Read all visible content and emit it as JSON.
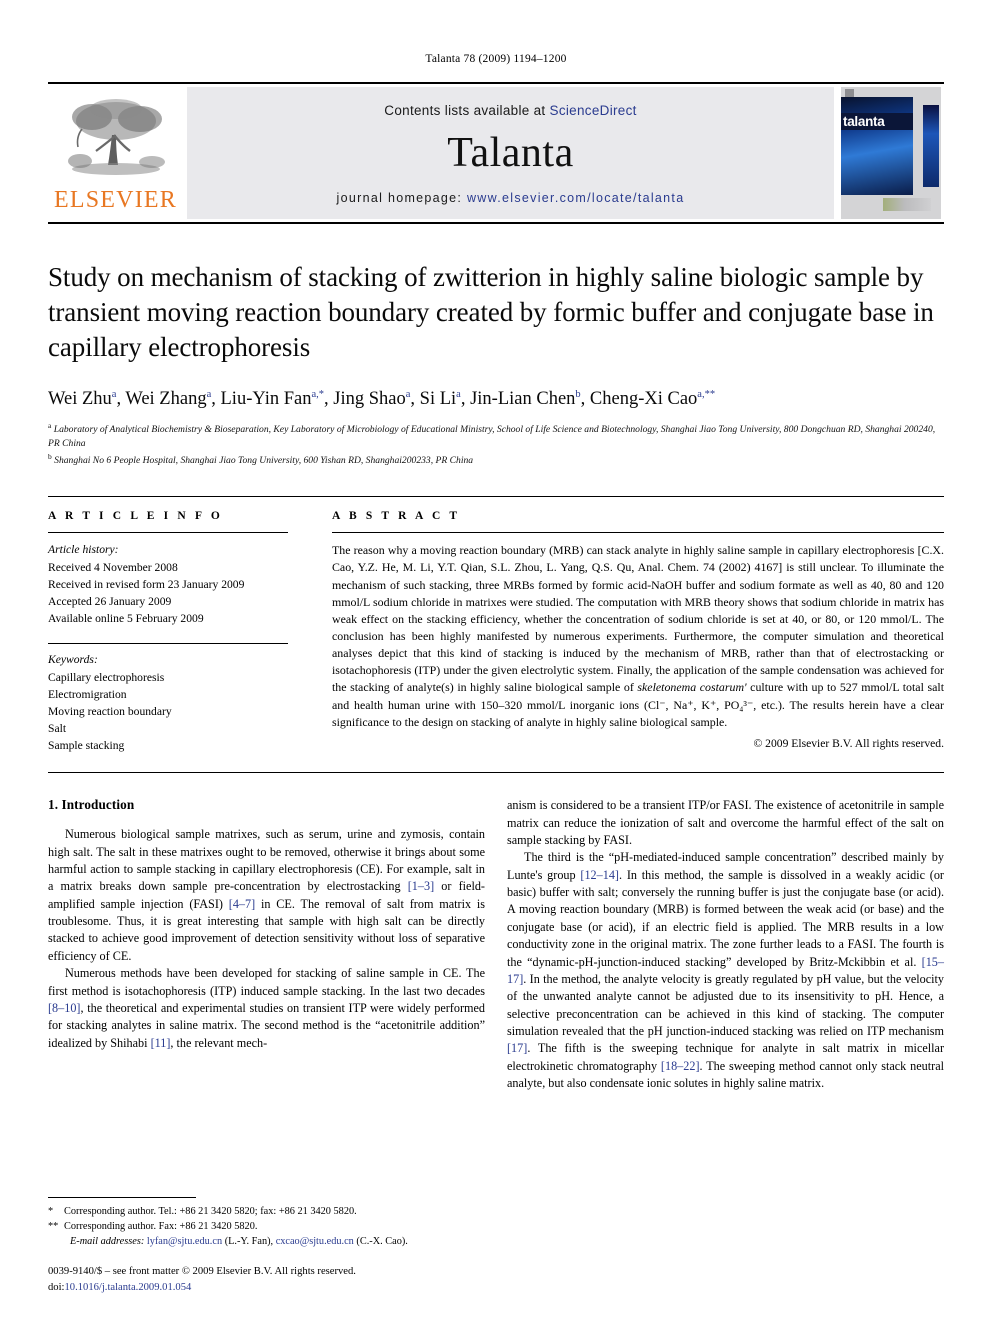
{
  "running_head": "Talanta 78 (2009) 1194–1200",
  "masthead": {
    "publisher_logo_word": "ELSEVIER",
    "contents_prefix": "Contents lists available at",
    "contents_link": "ScienceDirect",
    "journal_name": "Talanta",
    "homepage_prefix": "journal homepage:",
    "homepage_url": "www.elsevier.com/locate/talanta",
    "cover_title": "talanta",
    "link_color": "#2a3b8f",
    "elsevier_orange": "#E87722"
  },
  "article": {
    "title": "Study on mechanism of stacking of zwitterion in highly saline biologic sample by transient moving reaction boundary created by formic buffer and conjugate base in capillary electrophoresis",
    "authors": "Wei Zhu, Wei Zhang, Liu-Yin Fan, Jing Shao, Si Li, Jin-Lian Chen, Cheng-Xi Cao",
    "affiliation_a": "Laboratory of Analytical Biochemistry & Bioseparation, Key Laboratory of Microbiology of Educational Ministry, School of Life Science and Biotechnology, Shanghai Jiao Tong University, 800 Dongchuan RD, Shanghai 200240, PR China",
    "affiliation_b": "Shanghai No 6 People Hospital, Shanghai Jiao Tong University, 600 Yishan RD, Shanghai200233, PR China"
  },
  "info": {
    "heading": "A R T I C L E    I N F O",
    "history_label": "Article history:",
    "history": [
      "Received 4 November 2008",
      "Received in revised form 23 January 2009",
      "Accepted 26 January 2009",
      "Available online 5 February 2009"
    ],
    "keywords_label": "Keywords:",
    "keywords": [
      "Capillary electrophoresis",
      "Electromigration",
      "Moving reaction boundary",
      "Salt",
      "Sample stacking"
    ]
  },
  "abstract": {
    "heading": "A B S T R A C T",
    "text_part1": "The reason why a moving reaction boundary (MRB) can stack analyte in highly saline sample in capillary electrophoresis [C.X. Cao, Y.Z. He, M. Li, Y.T. Qian, S.L. Zhou, L. Yang, Q.S. Qu, Anal. Chem. 74 (2002) 4167] is still unclear. To illuminate the mechanism of such stacking, three MRBs formed by formic acid-NaOH buffer and sodium formate as well as 40, 80 and 120 mmol/L sodium chloride in matrixes were studied. The computation with MRB theory shows that sodium chloride in matrix has weak effect on the stacking efficiency, whether the concentration of sodium chloride is set at 40, or 80, or 120 mmol/L. The conclusion has been highly manifested by numerous experiments. Furthermore, the computer simulation and theoretical analyses depict that this kind of stacking is induced by the mechanism of MRB, rather than that of electrostacking or isotachophoresis (ITP) under the given electrolytic system. Finally, the application of the sample condensation was achieved for the stacking of analyte(s) in highly saline biological sample of ",
    "italic_species": "skeletonema costarum'",
    "text_part2": " culture with up to 527 mmol/L total salt and health human urine with 150–320 mmol/L inorganic ions (Cl⁻, Na⁺, K⁺, PO₄³⁻, etc.). The results herein have a clear significance to the design on stacking of analyte in highly saline biological sample.",
    "copyright": "© 2009 Elsevier B.V. All rights reserved."
  },
  "intro": {
    "heading": "1.  Introduction",
    "left_p1_a": "Numerous biological sample matrixes, such as serum, urine and zymosis, contain high salt. The salt in these matrixes ought to be removed, otherwise it brings about some harmful action to sample stacking in capillary electrophoresis (CE). For example, salt in a matrix breaks down sample pre-concentration by electrostacking ",
    "left_p1_r1": "[1–3]",
    "left_p1_b": " or field-amplified sample injection (FASI) ",
    "left_p1_r2": "[4–7]",
    "left_p1_c": " in CE. The removal of salt from matrix is troublesome. Thus, it is great interesting that sample with high salt can be directly stacked to achieve good improvement of detection sensitivity without loss of separative efficiency of CE.",
    "left_p2_a": "Numerous methods have been developed for stacking of saline sample in CE. The first method is isotachophoresis (ITP) induced sample stacking. In the last two decades ",
    "left_p2_r1": "[8–10]",
    "left_p2_b": ", the theoretical and experimental studies on transient ITP were widely performed for stacking analytes in saline matrix. The second method is the “acetonitrile addition” idealized by Shihabi ",
    "left_p2_r2": "[11]",
    "left_p2_c": ", the relevant mech-",
    "right_p1": "anism is considered to be a transient ITP/or FASI. The existence of acetonitrile in sample matrix can reduce the ionization of salt and overcome the harmful effect of the salt on sample stacking by FASI.",
    "right_p2_a": "The third is the “pH-mediated-induced sample concentration” described mainly by Lunte's group ",
    "right_p2_r1": "[12–14]",
    "right_p2_b": ". In this method, the sample is dissolved in a weakly acidic (or basic) buffer with salt; conversely the running buffer is just the conjugate base (or acid). A moving reaction boundary (MRB) is formed between the weak acid (or base) and the conjugate base (or acid), if an electric field is applied. The MRB results in a low conductivity zone in the original matrix. The zone further leads to a FASI. The fourth is the “dynamic-pH-junction-induced stacking” developed by Britz-Mckibbin et al. ",
    "right_p2_r2": "[15–17]",
    "right_p2_c": ". In the method, the analyte velocity is greatly regulated by pH value, but the velocity of the unwanted analyte cannot be adjusted due to its insensitivity to pH. Hence, a selective preconcentration can be achieved in this kind of stacking. The computer simulation revealed that the pH junction-induced stacking was relied on ITP mechanism ",
    "right_p2_r3": "[17]",
    "right_p2_d": ". The fifth is the sweeping technique for analyte in salt matrix in micellar electrokinetic chromatography ",
    "right_p2_r4": "[18–22]",
    "right_p2_e": ". The sweeping method cannot only stack neutral analyte, but also condensate ionic solutes in highly saline matrix."
  },
  "footnotes": {
    "fn1_mark": "*",
    "fn1": "Corresponding author. Tel.: +86 21 3420 5820; fax: +86 21 3420 5820.",
    "fn2_mark": "**",
    "fn2": "Corresponding author. Fax: +86 21 3420 5820.",
    "email_label": "E-mail addresses:",
    "email1": "lyfan@sjtu.edu.cn",
    "email1_who": "(L.-Y. Fan),",
    "email2": "cxcao@sjtu.edu.cn",
    "email2_who": "(C.-X. Cao).",
    "frontmatter": "0039-9140/$ – see front matter © 2009 Elsevier B.V. All rights reserved.",
    "doi_label": "doi:",
    "doi": "10.1016/j.talanta.2009.01.054"
  }
}
